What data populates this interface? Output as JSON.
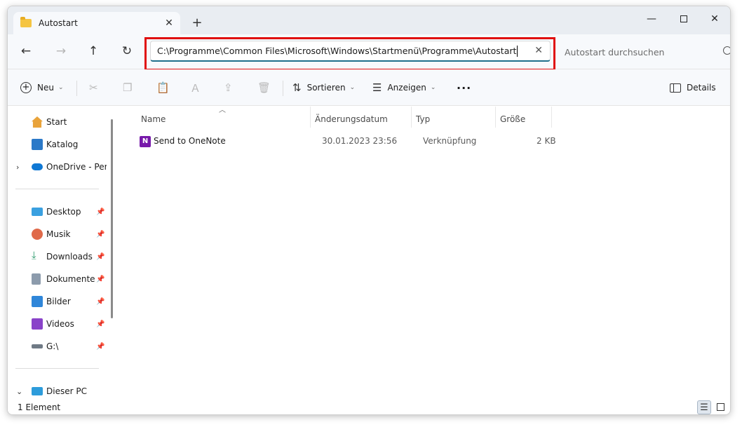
{
  "window": {
    "tab_title": "Autostart",
    "tab_close": "✕",
    "new_tab": "+",
    "minimize": "—",
    "close": "✕"
  },
  "nav": {
    "back": "←",
    "forward": "→",
    "up": "↑",
    "refresh": "↻",
    "address_path": "C:\\Programme\\Common Files\\Microsoft\\Windows\\Startmenü\\Programme\\Autostart",
    "address_clear": "✕",
    "search_placeholder": "Autostart durchsuchen"
  },
  "toolbar": {
    "new_label": "Neu",
    "sort_label": "Sortieren",
    "view_label": "Anzeigen",
    "more_label": "···",
    "details_label": "Details"
  },
  "sidebar": {
    "items": [
      {
        "label": "Start",
        "icon": "home-icon"
      },
      {
        "label": "Katalog",
        "icon": "gallery-icon"
      },
      {
        "label": "OneDrive - Persönlich",
        "icon": "cloud-icon"
      },
      {
        "label": "Desktop",
        "icon": "desktop-icon"
      },
      {
        "label": "Musik",
        "icon": "music-icon"
      },
      {
        "label": "Downloads",
        "icon": "download-icon"
      },
      {
        "label": "Dokumente",
        "icon": "document-icon"
      },
      {
        "label": "Bilder",
        "icon": "pictures-icon"
      },
      {
        "label": "Videos",
        "icon": "video-icon"
      },
      {
        "label": "G:\\",
        "icon": "drive-icon"
      },
      {
        "label": "Dieser PC",
        "icon": "computer-icon"
      }
    ]
  },
  "columns": {
    "name": "Name",
    "date": "Änderungsdatum",
    "type": "Typ",
    "size": "Größe"
  },
  "files": [
    {
      "name": "Send to OneNote",
      "date": "30.01.2023 23:56",
      "type": "Verknüpfung",
      "size": "2 KB"
    }
  ],
  "status": {
    "count": "1 Element"
  },
  "colors": {
    "accent": "#1f6f8b",
    "highlight": "#e01010",
    "onenote": "#7719aa"
  }
}
